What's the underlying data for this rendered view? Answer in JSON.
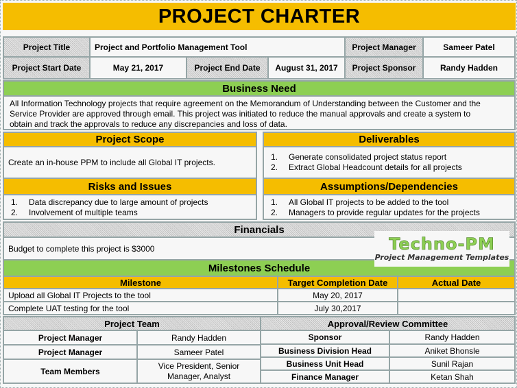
{
  "title": "PROJECT CHARTER",
  "header": {
    "project_title_label": "Project Title",
    "project_title_value": "Project and Portfolio Management Tool",
    "project_manager_label": "Project Manager",
    "project_manager_value": "Sameer Patel",
    "start_date_label": "Project Start Date",
    "start_date_value": "May 21, 2017",
    "end_date_label": "Project End Date",
    "end_date_value": "August 31, 2017",
    "sponsor_label": "Project Sponsor",
    "sponsor_value": "Randy Hadden"
  },
  "business_need": {
    "heading": "Business Need",
    "lines": [
      "All  Information Technology projects that require agreement on the Memorandum of Understanding  between the Customer and the",
      "Service Provider are approved  through email. This project was initiated to reduce the manual approvals and create a system to",
      "obtain and track the approvals to reduce any discrepancies and loss of data."
    ]
  },
  "project_scope": {
    "heading": "Project Scope",
    "text": "Create an in-house PPM to include all Global IT projects."
  },
  "deliverables": {
    "heading": "Deliverables",
    "items": [
      {
        "num": "1.",
        "text": "Generate consolidated project status report"
      },
      {
        "num": "2.",
        "text": "Extract Global Headcount details for all projects"
      }
    ]
  },
  "risks": {
    "heading": "Risks and Issues",
    "items": [
      {
        "num": "1.",
        "text": "Data discrepancy due to large amount of projects"
      },
      {
        "num": "2.",
        "text": "Involvement  of multiple teams"
      }
    ]
  },
  "assumptions": {
    "heading": "Assumptions/Dependencies",
    "items": [
      {
        "num": "1.",
        "text": "All Global IT projects to be added to the tool"
      },
      {
        "num": "2.",
        "text": "Managers to provide regular updates for the projects"
      }
    ]
  },
  "financials": {
    "heading": "Financials",
    "text": "Budget to complete this project is $3000"
  },
  "logo": {
    "main": "Techno-PM",
    "sub": "Project Management Templates"
  },
  "milestones": {
    "heading": "Milestones  Schedule",
    "columns": [
      "Milestone",
      "Target Completion Date",
      "Actual Date"
    ],
    "rows": [
      {
        "milestone": "Upload all Global IT Projects to the tool",
        "target": "May 20, 2017",
        "actual": ""
      },
      {
        "milestone": "Complete UAT testing for the tool",
        "target": "July 30,2017",
        "actual": ""
      }
    ]
  },
  "project_team": {
    "heading": "Project Team",
    "rows": [
      {
        "role": "Project Manager",
        "name": "Randy Hadden"
      },
      {
        "role": "Project Manager",
        "name": "Sameer Patel"
      },
      {
        "role": "Team Members",
        "name_line1": "Vice President, Senior",
        "name_line2": "Manager, Analyst"
      }
    ]
  },
  "committee": {
    "heading": "Approval/Review Committee",
    "rows": [
      {
        "role": "Sponsor",
        "name": "Randy Hadden"
      },
      {
        "role": "Business Division Head",
        "name": "Aniket Bhonsle"
      },
      {
        "role": "Business Unit Head",
        "name": "Sunil Rajan"
      },
      {
        "role": "Finance Manager",
        "name": "Ketan Shah"
      }
    ]
  },
  "colors": {
    "yellow": "#f5bd00",
    "green": "#8dcf53",
    "border": "#95a5a6",
    "cell_bg": "#f7f7f7"
  }
}
